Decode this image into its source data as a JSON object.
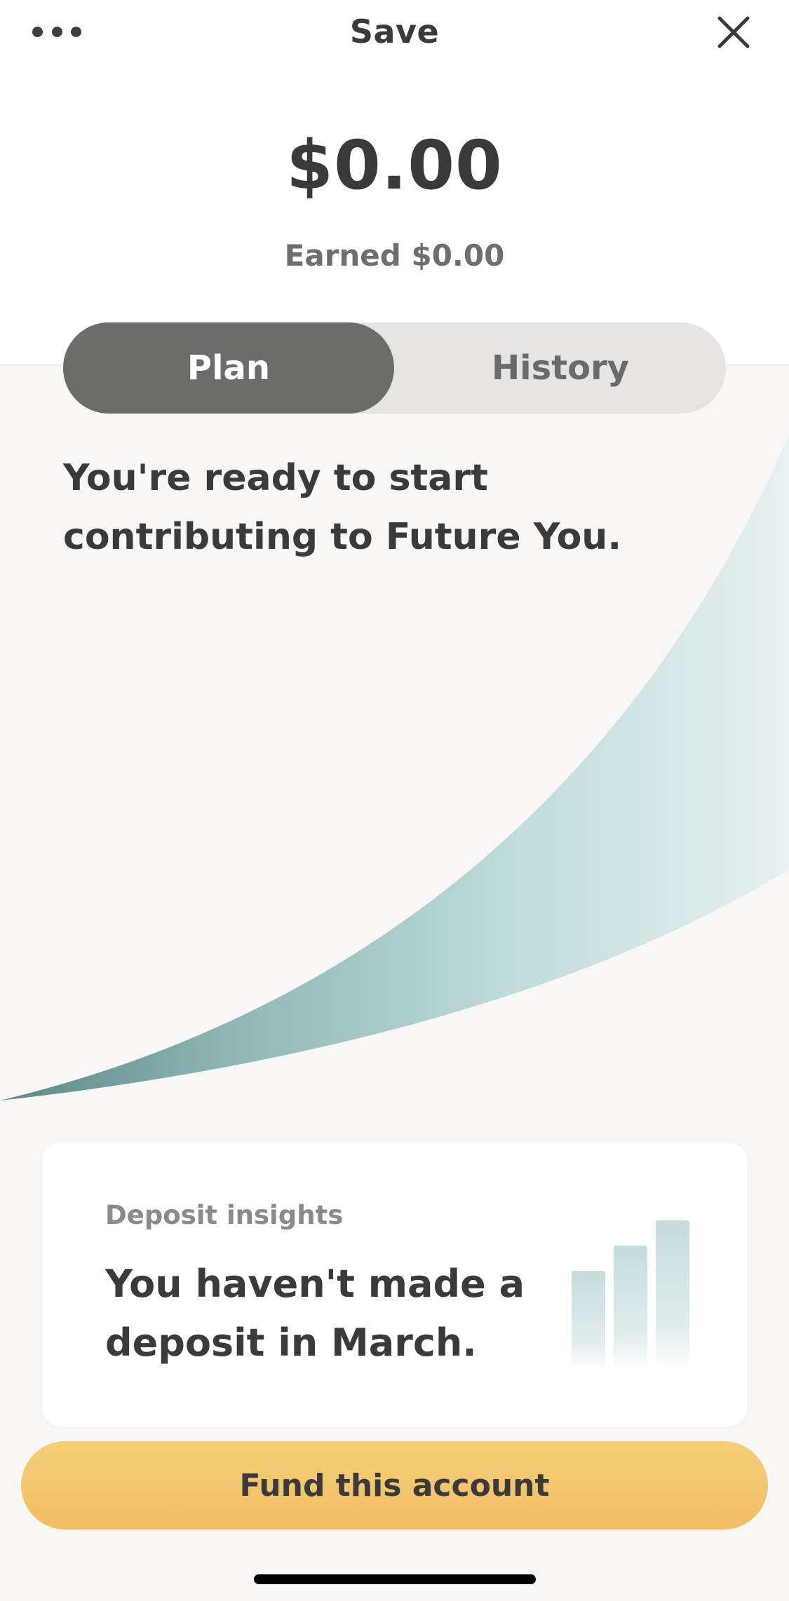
{
  "nav": {
    "title": "Save",
    "more_icon": "ellipsis-icon",
    "close_icon": "close-icon"
  },
  "balance": {
    "amount": "$0.00",
    "earned": "Earned $0.00"
  },
  "tabs": [
    {
      "label": "Plan",
      "selected": true
    },
    {
      "label": "History",
      "selected": false
    }
  ],
  "plan": {
    "headline": "You're ready to start contributing to Future You."
  },
  "insight": {
    "label": "Deposit insights",
    "text": "You haven't made a deposit in March.",
    "icon": "bar-chart-icon"
  },
  "actions": {
    "fund_label": "Fund this account"
  },
  "colors": {
    "background": "#f8f7f6",
    "segment_active": "#6c6c6b",
    "segment_track": "#e5e4e2",
    "curve_dark": "#5e8b89",
    "curve_light": "#e5f0ef",
    "button": "#f2c46a",
    "text": "#3a3a3a"
  }
}
